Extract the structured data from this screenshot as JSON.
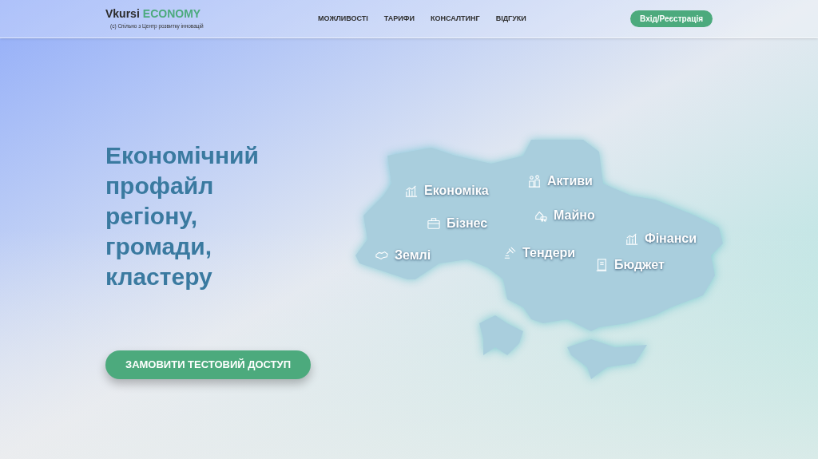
{
  "header": {
    "logo": {
      "brand": "Vkursi",
      "product": "ECONOMY",
      "tagline": "(с) Спільно з Центр розвитку інновацій"
    },
    "nav": [
      "МОЖЛИВОСТІ",
      "ТАРИФИ",
      "КОНСАЛТИНГ",
      "ВІДГУКИ"
    ],
    "login_button": "Вхід/Реєстрація"
  },
  "hero": {
    "title": "Економічний профайл регіону, громади, кластеру",
    "cta_button": "ЗАМОВИТИ ТЕСТОВИЙ ДОСТУП",
    "map_labels": [
      {
        "text": "Економіка",
        "kind": "chart"
      },
      {
        "text": "Активи",
        "kind": "people"
      },
      {
        "text": "Бізнес",
        "kind": "briefcase"
      },
      {
        "text": "Майно",
        "kind": "property"
      },
      {
        "text": "Землі",
        "kind": "land"
      },
      {
        "text": "Тендери",
        "kind": "gavel"
      },
      {
        "text": "Фінанси",
        "kind": "chart"
      },
      {
        "text": "Бюджет",
        "kind": "document"
      }
    ]
  }
}
